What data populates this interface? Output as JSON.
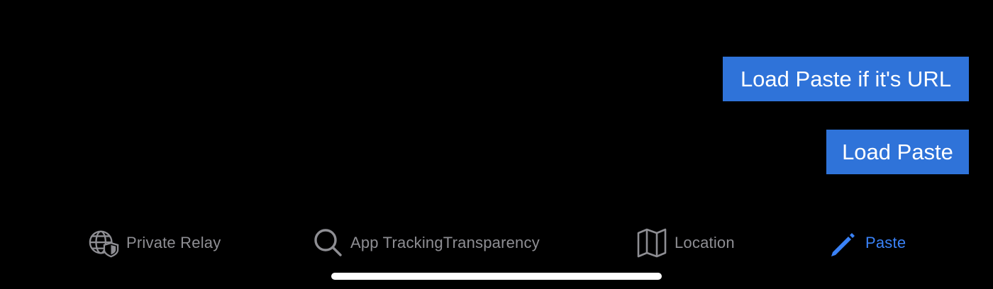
{
  "buttons": {
    "load_paste_url": "Load Paste if it's URL",
    "load_paste": "Load Paste"
  },
  "tabbar": {
    "tabs": [
      {
        "label": "Private Relay",
        "icon": "globe-shield-icon",
        "active": false
      },
      {
        "label": "App TrackingTransparency",
        "icon": "magnifying-glass-icon",
        "active": false
      },
      {
        "label": "Location",
        "icon": "map-icon",
        "active": false
      },
      {
        "label": "Paste",
        "icon": "pencil-icon",
        "active": true
      }
    ]
  },
  "colors": {
    "background": "#000000",
    "button": "#2f73d9",
    "button_text": "#ffffff",
    "tab_inactive": "#8e8e93",
    "tab_active": "#3a82f7",
    "home_indicator": "#ffffff"
  }
}
